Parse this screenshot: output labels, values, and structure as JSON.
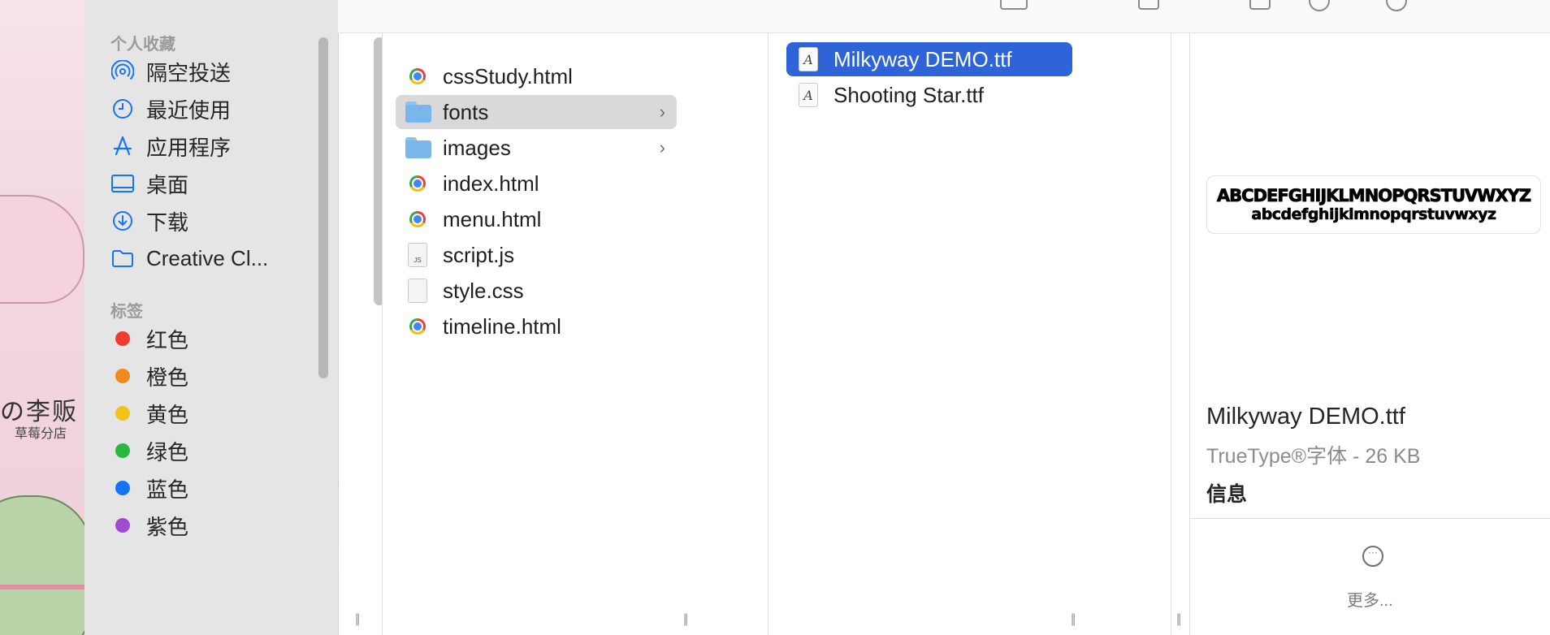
{
  "sidebar": {
    "favorites_heading": "个人收藏",
    "favorites": [
      {
        "label": "隔空投送",
        "icon": "airdrop-icon"
      },
      {
        "label": "最近使用",
        "icon": "clock-icon"
      },
      {
        "label": "应用程序",
        "icon": "applications-icon"
      },
      {
        "label": "桌面",
        "icon": "desktop-icon"
      },
      {
        "label": "下载",
        "icon": "download-icon"
      },
      {
        "label": "Creative Cl...",
        "icon": "folder-icon"
      }
    ],
    "tags_heading": "标签",
    "tags": [
      {
        "label": "红色",
        "color": "#f03b2f"
      },
      {
        "label": "橙色",
        "color": "#f08a1c"
      },
      {
        "label": "黄色",
        "color": "#f0c31b"
      },
      {
        "label": "绿色",
        "color": "#2ab740"
      },
      {
        "label": "蓝色",
        "color": "#1574f5"
      },
      {
        "label": "紫色",
        "color": "#a04bd0"
      }
    ]
  },
  "columns": {
    "project_files": [
      {
        "name": "cssStudy.html",
        "type": "html",
        "chevron": ""
      },
      {
        "name": "fonts",
        "type": "folder",
        "chevron": "›"
      },
      {
        "name": "images",
        "type": "folder",
        "chevron": "›"
      },
      {
        "name": "index.html",
        "type": "html",
        "chevron": ""
      },
      {
        "name": "menu.html",
        "type": "html",
        "chevron": ""
      },
      {
        "name": "script.js",
        "type": "js",
        "chevron": ""
      },
      {
        "name": "style.css",
        "type": "css",
        "chevron": ""
      },
      {
        "name": "timeline.html",
        "type": "html",
        "chevron": ""
      }
    ],
    "fonts_files": [
      {
        "name": "Milkyway DEMO.ttf"
      },
      {
        "name": "Shooting Star.ttf"
      }
    ],
    "js_badge": "JS",
    "font_glyph": "A"
  },
  "preview": {
    "sample_upper": "ABCDEFGHIJKLMNOPQRSTUVWXYZ",
    "sample_lower": "abcdefghijklmnopqrstuvwxyz",
    "file_name": "Milkyway DEMO.ttf",
    "meta": "TrueType®字体 - 26 KB",
    "info_heading": "信息",
    "more_label": "更多...",
    "more_glyph": "···"
  },
  "colors": {
    "selection_blue": "#2f64d8",
    "selection_gray": "#d9d9db",
    "sidebar_bg": "#e6e5e6",
    "accent_blue": "#1574f5"
  }
}
